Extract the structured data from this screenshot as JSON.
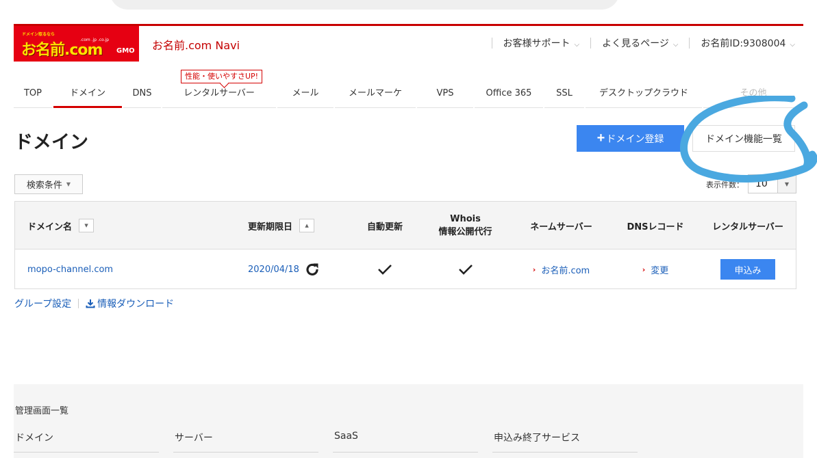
{
  "logo": {
    "tagline": "ドメイン取るなら",
    "brand": "お名前.com",
    "tlds": ".com .jp .co.jp",
    "corp": "GMO"
  },
  "header": {
    "navi_title": "お名前.com Navi",
    "menu": [
      {
        "label": "お客様サポート"
      },
      {
        "label": "よく見るページ"
      },
      {
        "label": "お名前ID:9308004"
      }
    ]
  },
  "nav": {
    "badge": "性能・使いやすさUP!",
    "tabs": [
      {
        "label": "TOP"
      },
      {
        "label": "ドメイン"
      },
      {
        "label": "DNS"
      },
      {
        "label": "レンタルサーバー"
      },
      {
        "label": "メール"
      },
      {
        "label": "メールマーケ"
      },
      {
        "label": "VPS"
      },
      {
        "label": "Office 365"
      },
      {
        "label": "SSL"
      },
      {
        "label": "デスクトップクラウド"
      },
      {
        "label": "その他"
      }
    ],
    "active_tab": "ドメイン"
  },
  "page": {
    "title": "ドメイン",
    "register_button": "ドメイン登録",
    "features_button": "ドメイン機能一覧",
    "search_conditions": "検索条件",
    "count_label": "表示件数：",
    "count_value": "10"
  },
  "table": {
    "headers": {
      "domain": "ドメイン名",
      "expiry": "更新期限日",
      "auto_renew": "自動更新",
      "whois_line1": "Whois",
      "whois_line2": "情報公開代行",
      "nameserver": "ネームサーバー",
      "dns": "DNSレコード",
      "rental": "レンタルサーバー"
    },
    "rows": [
      {
        "domain": "mopo-channel.com",
        "expiry": "2020/04/18",
        "nameserver": "お名前.com",
        "dns": "変更",
        "rental": "申込み"
      }
    ]
  },
  "links": {
    "group": "グループ設定",
    "download": "情報ダウンロード"
  },
  "footer": {
    "title": "管理画面一覧",
    "columns": [
      {
        "label": "ドメイン"
      },
      {
        "label": "サーバー"
      },
      {
        "label": "SaaS"
      },
      {
        "label": "申込み終了サービス"
      }
    ]
  },
  "colors": {
    "brand_red": "#e60012",
    "brand_yellow": "#ffe100",
    "accent_blue": "#3b86f0",
    "link_blue": "#1a5eb8",
    "annotation_blue": "#4aa8e0"
  }
}
